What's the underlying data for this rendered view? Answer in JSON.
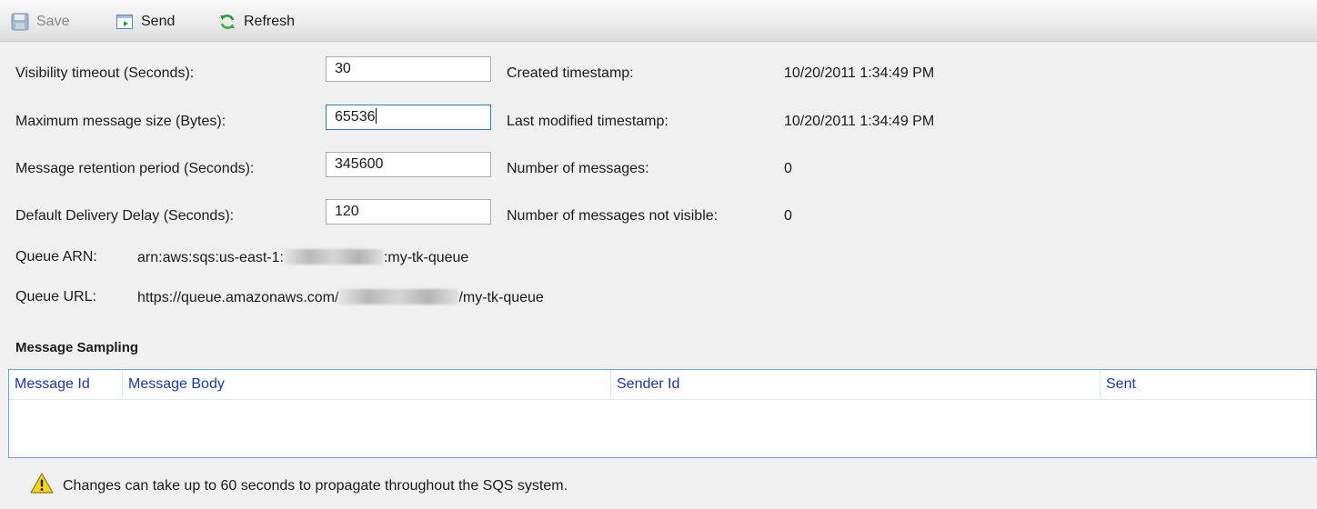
{
  "toolbar": {
    "save_label": "Save",
    "send_label": "Send",
    "refresh_label": "Refresh"
  },
  "settings": {
    "visibility_timeout_label": "Visibility timeout (Seconds):",
    "visibility_timeout_value": "30",
    "max_message_size_label": "Maximum message size (Bytes):",
    "max_message_size_value": "65536",
    "retention_period_label": "Message retention period (Seconds):",
    "retention_period_value": "345600",
    "delivery_delay_label": "Default Delivery Delay (Seconds):",
    "delivery_delay_value": "120"
  },
  "info": {
    "created_label": "Created timestamp:",
    "created_value": "10/20/2011 1:34:49 PM",
    "modified_label": "Last modified timestamp:",
    "modified_value": "10/20/2011 1:34:49 PM",
    "num_messages_label": "Number of messages:",
    "num_messages_value": "0",
    "not_visible_label": "Number of messages not visible:",
    "not_visible_value": "0"
  },
  "queue": {
    "arn_label": "Queue ARN:",
    "arn_prefix": "arn:aws:sqs:us-east-1:",
    "arn_suffix": ":my-tk-queue",
    "url_label": "Queue URL:",
    "url_prefix": "https://queue.amazonaws.com/",
    "url_suffix": "/my-tk-queue"
  },
  "sampling": {
    "title": "Message Sampling",
    "columns": [
      "Message Id",
      "Message Body",
      "Sender Id",
      "Sent"
    ]
  },
  "footer": {
    "note": "Changes can take up to 60 seconds to propagate throughout the SQS system."
  },
  "icons": {
    "save": "floppy-disk-icon",
    "send": "send-message-icon",
    "refresh": "refresh-arrows-icon",
    "warning": "warning-triangle-icon"
  },
  "colors": {
    "column_header_text": "#1e3a8f",
    "grid_border": "#7fa1c8",
    "warning_yellow": "#f3d21a"
  }
}
